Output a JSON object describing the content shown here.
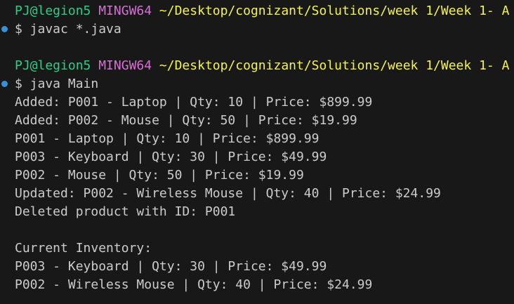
{
  "prompts": [
    {
      "user": "PJ@legion5",
      "system": "MINGW64",
      "path": "~/Desktop/cognizant/Solutions/week 1/Week 1- A",
      "command": "$ javac *.java",
      "status_color": "#3a8fd6"
    },
    {
      "user": "PJ@legion5",
      "system": "MINGW64",
      "path": "~/Desktop/cognizant/Solutions/week 1/Week 1- A",
      "command": "$ java Main",
      "status_color": "#3a8fd6"
    }
  ],
  "output": [
    "Added: P001 - Laptop | Qty: 10 | Price: $899.99",
    "Added: P002 - Mouse | Qty: 50 | Price: $19.99",
    "P001 - Laptop | Qty: 10 | Price: $899.99",
    "P003 - Keyboard | Qty: 30 | Price: $49.99",
    "P002 - Mouse | Qty: 50 | Price: $19.99",
    "Updated: P002 - Wireless Mouse | Qty: 40 | Price: $24.99",
    "Deleted product with ID: P001",
    "",
    "Current Inventory:",
    "P003 - Keyboard | Qty: 30 | Price: $49.99",
    "P002 - Wireless Mouse | Qty: 40 | Price: $24.99"
  ],
  "colors": {
    "background": "#181818",
    "text": "#cccccc",
    "user": "#23d18b",
    "system": "#d670d6",
    "path": "#f5f543"
  }
}
